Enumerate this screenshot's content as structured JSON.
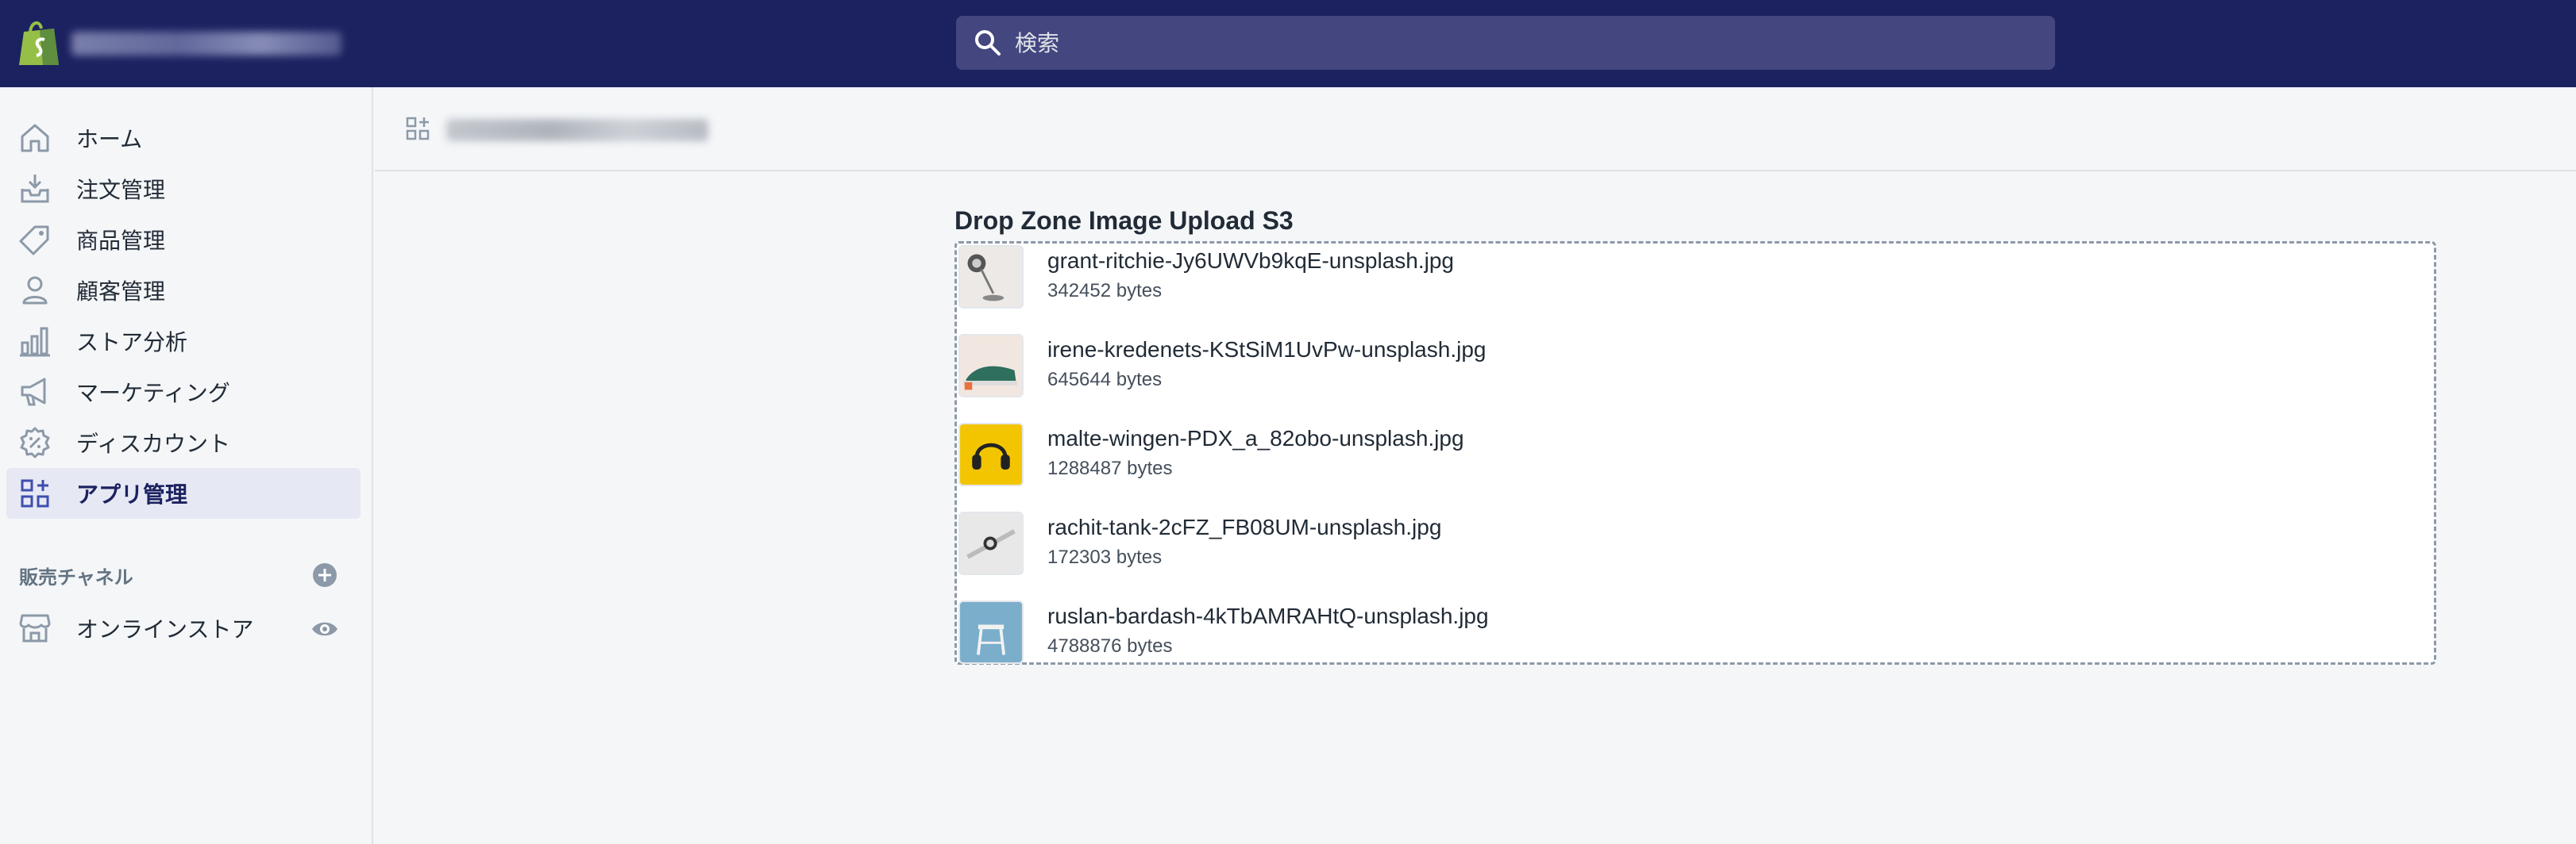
{
  "topbar": {
    "search_placeholder": "検索",
    "logo_icon": "shopify-bag-icon",
    "search_icon": "search-icon"
  },
  "sidebar": {
    "items": [
      {
        "label": "ホーム",
        "icon": "home-icon"
      },
      {
        "label": "注文管理",
        "icon": "inbox-icon"
      },
      {
        "label": "商品管理",
        "icon": "tag-icon"
      },
      {
        "label": "顧客管理",
        "icon": "person-icon"
      },
      {
        "label": "ストア分析",
        "icon": "bar-chart-icon"
      },
      {
        "label": "マーケティング",
        "icon": "megaphone-icon"
      },
      {
        "label": "ディスカウント",
        "icon": "discount-icon"
      },
      {
        "label": "アプリ管理",
        "icon": "apps-icon",
        "active": true
      }
    ],
    "sales_channels_label": "販売チャネル",
    "online_store_label": "オンラインストア"
  },
  "dropzone": {
    "title": "Drop Zone Image Upload S3",
    "files": [
      {
        "name": "grant-ritchie-Jy6UWVb9kqE-unsplash.jpg",
        "size": "342452 bytes"
      },
      {
        "name": "irene-kredenets-KStSiM1UvPw-unsplash.jpg",
        "size": "645644 bytes"
      },
      {
        "name": "malte-wingen-PDX_a_82obo-unsplash.jpg",
        "size": "1288487 bytes"
      },
      {
        "name": "rachit-tank-2cFZ_FB08UM-unsplash.jpg",
        "size": "172303 bytes"
      },
      {
        "name": "ruslan-bardash-4kTbAMRAHtQ-unsplash.jpg",
        "size": "4788876 bytes"
      }
    ]
  },
  "colors": {
    "topbar_bg": "#1c2260",
    "search_bg": "#43467f",
    "active_nav_bg": "#e6e8f4",
    "page_bg": "#f4f6f8"
  }
}
